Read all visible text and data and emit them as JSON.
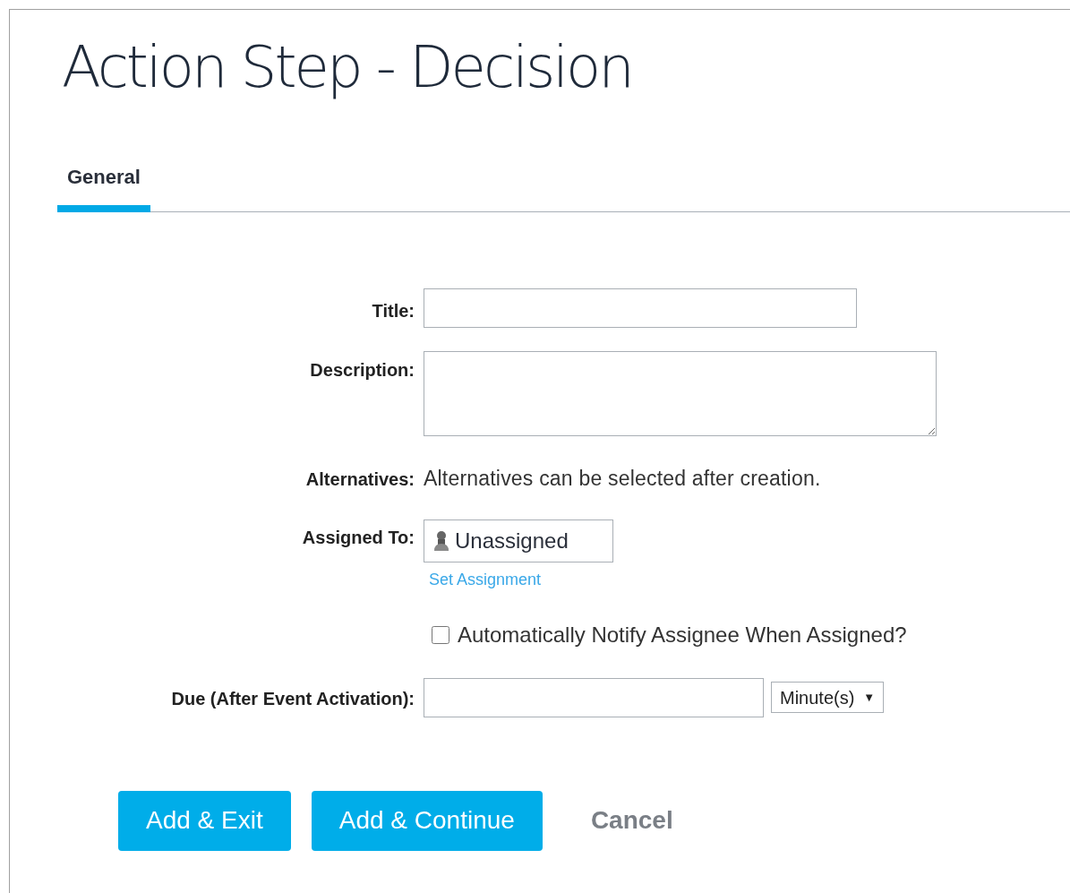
{
  "page_title": "Action Step - Decision",
  "tabs": [
    {
      "label": "General",
      "selected": true
    }
  ],
  "fields": [
    {
      "kind": "text",
      "label": "Title:"
    },
    {
      "kind": "textarea",
      "label": "Description:"
    },
    {
      "kind": "note",
      "label": "Alternatives:",
      "text": "Alternatives can be selected after creation."
    },
    {
      "kind": "assignee",
      "label": "Assigned To:",
      "value": "Unassigned",
      "link": "Set Assignment"
    },
    {
      "kind": "checkbox",
      "text": "Automatically Notify Assignee When Assigned?",
      "checked": false
    },
    {
      "kind": "duration",
      "label": "Due (After Event Activation):",
      "unit": "Minute(s)",
      "caret": "▼"
    }
  ],
  "buttons": [
    {
      "kind": "primary",
      "label": "Add & Exit"
    },
    {
      "kind": "primary",
      "label": "Add & Continue"
    },
    {
      "kind": "plain",
      "label": "Cancel"
    }
  ]
}
